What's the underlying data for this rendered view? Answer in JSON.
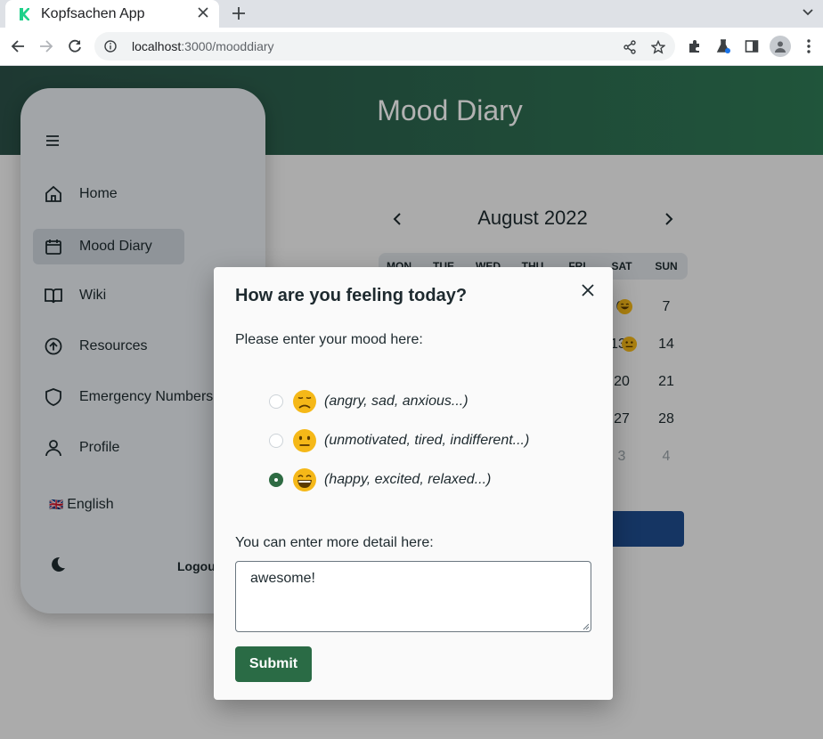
{
  "browser": {
    "tab_title": "Kopfsachen App",
    "url_host": "localhost",
    "url_rest": ":3000/mooddiary"
  },
  "page": {
    "title": "Mood Diary"
  },
  "sidebar": {
    "items": [
      {
        "label": "Home",
        "icon": "home-icon"
      },
      {
        "label": "Mood Diary",
        "icon": "calendar-icon"
      },
      {
        "label": "Wiki",
        "icon": "book-icon"
      },
      {
        "label": "Resources",
        "icon": "arrow-up-circle-icon"
      },
      {
        "label": "Emergency Numbers",
        "icon": "shield-icon"
      },
      {
        "label": "Profile",
        "icon": "user-icon"
      }
    ],
    "language": "English",
    "language_flag": "🇬🇧",
    "logout": "Logou"
  },
  "calendar": {
    "month": "August 2022",
    "weekdays": [
      "MON",
      "TUE",
      "WED",
      "THU",
      "FRI",
      "SAT",
      "SUN"
    ],
    "visible_days": [
      "6",
      "7",
      "13",
      "14",
      "20",
      "21",
      "27",
      "28",
      "3",
      "4"
    ]
  },
  "modal": {
    "title": "How are you feeling today?",
    "mood_prompt": "Please enter your mood here:",
    "moods": [
      {
        "desc": "(angry, sad, anxious...)",
        "emoji": "sad-face",
        "selected": false
      },
      {
        "desc": "(unmotivated, tired, indifferent...)",
        "emoji": "neutral-face",
        "selected": false
      },
      {
        "desc": "(happy, excited, relaxed...)",
        "emoji": "happy-face",
        "selected": true
      }
    ],
    "detail_label": "You can enter more detail here:",
    "detail_value": "awesome!",
    "submit_label": "Submit"
  },
  "colors": {
    "header_start": "#2b5148",
    "header_end": "#2e7a55",
    "primary_green": "#2a6b45",
    "calendar_button": "#1f4c8f"
  }
}
